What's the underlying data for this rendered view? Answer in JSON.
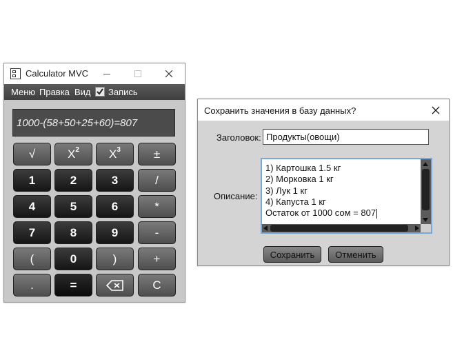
{
  "calculator": {
    "title": "Calculator MVC",
    "menu": [
      "Меню",
      "Правка",
      "Вид"
    ],
    "record_checkbox": {
      "label": "Запись",
      "checked": true
    },
    "display": "1000-(58+50+25+60)=807",
    "keys": [
      {
        "label": "√",
        "style": "grey",
        "name": "sqrt-key"
      },
      {
        "label": "X",
        "sup": "2",
        "style": "grey",
        "name": "square-key"
      },
      {
        "label": "X",
        "sup": "3",
        "style": "grey",
        "name": "cube-key"
      },
      {
        "label": "±",
        "style": "grey",
        "name": "plus-minus-key"
      },
      {
        "label": "1",
        "style": "dark",
        "name": "digit-1-key"
      },
      {
        "label": "2",
        "style": "dark",
        "name": "digit-2-key"
      },
      {
        "label": "3",
        "style": "dark",
        "name": "digit-3-key"
      },
      {
        "label": "/",
        "style": "grey",
        "name": "divide-key"
      },
      {
        "label": "4",
        "style": "dark",
        "name": "digit-4-key"
      },
      {
        "label": "5",
        "style": "dark",
        "name": "digit-5-key"
      },
      {
        "label": "6",
        "style": "dark",
        "name": "digit-6-key"
      },
      {
        "label": "*",
        "style": "grey",
        "name": "multiply-key"
      },
      {
        "label": "7",
        "style": "dark",
        "name": "digit-7-key"
      },
      {
        "label": "8",
        "style": "dark",
        "name": "digit-8-key"
      },
      {
        "label": "9",
        "style": "dark",
        "name": "digit-9-key"
      },
      {
        "label": "-",
        "style": "grey",
        "name": "minus-key"
      },
      {
        "label": "(",
        "style": "grey",
        "name": "open-paren-key"
      },
      {
        "label": "0",
        "style": "dark",
        "name": "digit-0-key"
      },
      {
        "label": ")",
        "style": "grey",
        "name": "close-paren-key"
      },
      {
        "label": "+",
        "style": "grey",
        "name": "plus-key"
      },
      {
        "label": ".",
        "style": "grey",
        "name": "decimal-key"
      },
      {
        "label": "=",
        "style": "eq",
        "name": "equals-key"
      },
      {
        "label": "",
        "icon": "backspace-icon",
        "style": "grey",
        "name": "backspace-key"
      },
      {
        "label": "C",
        "style": "grey",
        "name": "clear-key"
      }
    ]
  },
  "save_dialog": {
    "title": "Сохранить значения в базу данных?",
    "title_label": "Заголовок:",
    "title_value": "Продукты(овощи)",
    "description_label": "Описание:",
    "description_lines": [
      "1) Картошка 1.5 кг",
      "2) Морковка 1 кг",
      "3) Лук 1 кг",
      "4) Капуста 1 кг",
      "Остаток от 1000 сом = 807"
    ],
    "save_button": "Сохранить",
    "cancel_button": "Отменить"
  }
}
